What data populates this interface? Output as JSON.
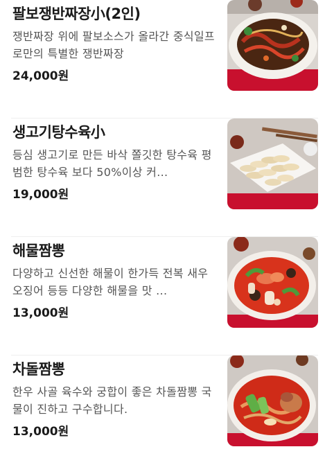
{
  "menu": {
    "items": [
      {
        "name": "팔보쟁반짜장小(2인)",
        "description": "쟁반짜장 위에 팔보소스가 올라간 중식일프로만의 특별한 쟁반짜장",
        "price": "24,000원",
        "image": "palbo-jajang-photo"
      },
      {
        "name": "생고기탕수육小",
        "description": "등심 생고기로 만든 바삭 쫄깃한 탕수육 평범한 탕수육 보다 50%이상 커...",
        "price": "19,000원",
        "image": "tangsuyuk-photo"
      },
      {
        "name": "해물짬뽕",
        "description": "다양하고 신선한 해물이 한가득 전복 새우 오징어 등등 다양한 해물을 맛 ...",
        "price": "13,000원",
        "image": "seafood-jjamppong-photo"
      },
      {
        "name": "차돌짬뽕",
        "description": "한우 사골 육수와 궁합이 좋은 차돌짬뽕 국물이 진하고 구수합니다.",
        "price": "13,000원",
        "image": "brisket-jjamppong-photo"
      }
    ]
  }
}
